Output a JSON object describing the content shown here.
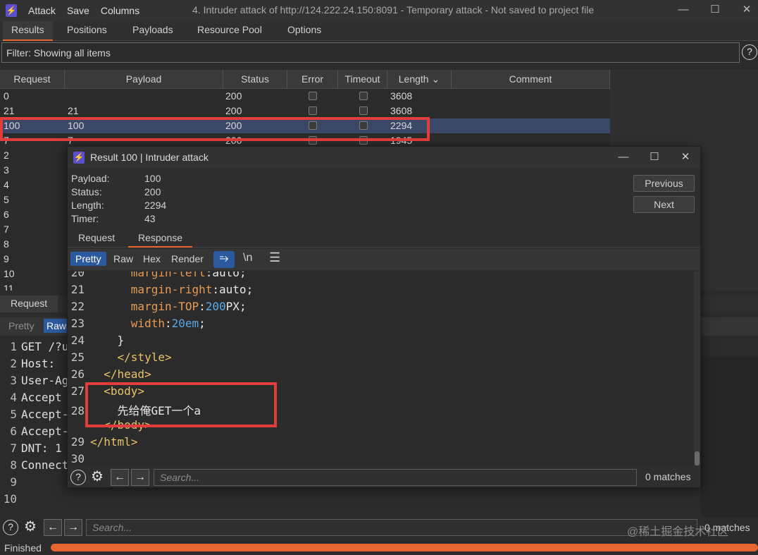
{
  "titlebar": {
    "menu": [
      "Attack",
      "Save",
      "Columns"
    ],
    "title": "4. Intruder attack of http://124.222.24.150:8091 - Temporary attack - Not saved to project file"
  },
  "main_tabs": [
    "Results",
    "Positions",
    "Payloads",
    "Resource Pool",
    "Options"
  ],
  "filter": {
    "text": "Filter: Showing all items",
    "help": "?"
  },
  "table": {
    "columns": [
      "Request",
      "Payload",
      "Status",
      "Error",
      "Timeout",
      "Length ⌄",
      "Comment"
    ],
    "rows": [
      {
        "request": "0",
        "payload": "",
        "status": "200",
        "length": "3608"
      },
      {
        "request": "21",
        "payload": "21",
        "status": "200",
        "length": "3608"
      },
      {
        "request": "100",
        "payload": "100",
        "status": "200",
        "length": "2294"
      },
      {
        "request": "7",
        "payload": "7",
        "status": "200",
        "length": "1945"
      }
    ],
    "extra_request_numbers": [
      "2",
      "3",
      "4",
      "5",
      "6",
      "7",
      "8",
      "9",
      "10",
      "11"
    ]
  },
  "request_pane": {
    "tab": "Request",
    "view_buttons": [
      "Pretty",
      "Raw"
    ],
    "lines": [
      {
        "n": "1",
        "t": "GET /?u"
      },
      {
        "n": "2",
        "t": "Host: "
      },
      {
        "n": "3",
        "t": "User-Ag"
      },
      {
        "n": "4",
        "t": "Accept"
      },
      {
        "n": "5",
        "t": "Accept-"
      },
      {
        "n": "6",
        "t": "Accept-"
      },
      {
        "n": "7",
        "t": "DNT: 1"
      },
      {
        "n": "8",
        "t": "Connect"
      },
      {
        "n": "9",
        "t": ""
      },
      {
        "n": "10",
        "t": ""
      }
    ],
    "search_placeholder": "Search...",
    "matches": "0 matches"
  },
  "status": {
    "text": "Finished",
    "progress": 1.0
  },
  "watermark": "@稀土掘金技术社区",
  "popup": {
    "title": "Result 100 | Intruder attack",
    "info": [
      {
        "label": "Payload:",
        "value": "100"
      },
      {
        "label": "Status:",
        "value": "200"
      },
      {
        "label": "Length:",
        "value": "2294"
      },
      {
        "label": "Timer:",
        "value": "43"
      }
    ],
    "buttons": {
      "previous": "Previous",
      "next": "Next"
    },
    "tabs": [
      "Request",
      "Response"
    ],
    "view_buttons": [
      "Pretty",
      "Raw",
      "Hex",
      "Render"
    ],
    "newline_toggle": "\\n",
    "code_lines": [
      {
        "n": "20",
        "indent": "      ",
        "prop": "margin-left",
        "value": "auto",
        "value_type": "text"
      },
      {
        "n": "21",
        "indent": "      ",
        "prop": "margin-right",
        "value": "auto",
        "value_type": "text"
      },
      {
        "n": "22",
        "indent": "      ",
        "prop": "margin-TOP",
        "value": "200",
        "unit": "PX",
        "value_type": "num"
      },
      {
        "n": "23",
        "indent": "      ",
        "prop": "width",
        "value": "20em",
        "value_type": "num"
      },
      {
        "n": "24",
        "indent": "    ",
        "raw": "}"
      },
      {
        "n": "25",
        "indent": "    ",
        "tag": "</style>"
      },
      {
        "n": "26",
        "indent": "  ",
        "tag": "</head>"
      },
      {
        "n": "27",
        "indent": "  ",
        "tag": "<body>"
      },
      {
        "n": "28",
        "indent": "    ",
        "raw": "先给俺GET一个a"
      },
      {
        "n": "",
        "indent": "  ",
        "tag": "</body>"
      },
      {
        "n": "29",
        "indent": "",
        "tag": "</html>"
      },
      {
        "n": "30",
        "indent": "",
        "raw": ""
      }
    ],
    "search_placeholder": "Search...",
    "matches": "0 matches"
  },
  "colors": {
    "accent": "#e8662f",
    "selection": "#3b4767",
    "highlight_box": "#e23d3d",
    "primary_button": "#2c5aa0"
  }
}
